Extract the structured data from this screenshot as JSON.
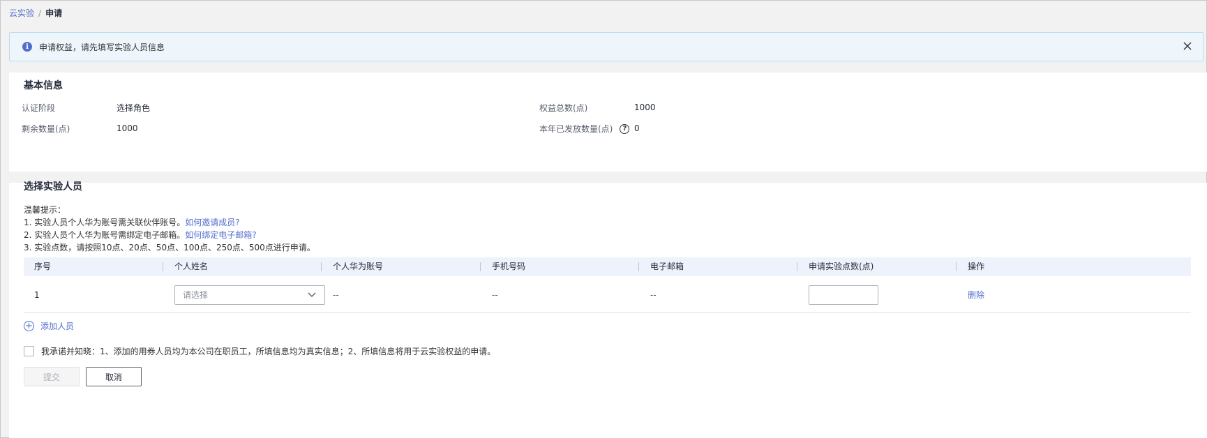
{
  "breadcrumb": {
    "parent": "云实验",
    "separator": "/",
    "current": "申请"
  },
  "alert": {
    "message": "申请权益，请先填写实验人员信息"
  },
  "basic_info": {
    "title": "基本信息",
    "stage_label": "认证阶段",
    "stage_value": "选择角色",
    "total_label": "权益总数(点)",
    "total_value": "1000",
    "remaining_label": "剩余数量(点)",
    "remaining_value": "1000",
    "issued_label": "本年已发放数量(点)",
    "issued_value": "0"
  },
  "select_staff": {
    "title": "选择实验人员",
    "tips_title": "温馨提示：",
    "tip1_text": "1. 实验人员个人华为账号需关联伙伴账号。",
    "tip1_link": "如何邀请成员?",
    "tip2_text": "2. 实验人员个人华为账号需绑定电子邮箱。",
    "tip2_link": "如何绑定电子邮箱?",
    "tip3_text": "3. 实验点数，请按照10点、20点、50点、100点、250点、500点进行申请。"
  },
  "table": {
    "headers": [
      "序号",
      "个人姓名",
      "个人华为账号",
      "手机号码",
      "电子邮箱",
      "申请实验点数(点)",
      "操作"
    ],
    "rows": [
      {
        "index": "1",
        "name_placeholder": "请选择",
        "account": "--",
        "phone": "--",
        "email": "--",
        "points": "",
        "action": "删除"
      }
    ]
  },
  "add_person_label": "添加人员",
  "agreement_text": "我承诺并知晓：1、添加的用券人员均为本公司在职员工，所填信息均为真实信息；2、所填信息将用于云实验权益的申请。",
  "buttons": {
    "submit": "提交",
    "cancel": "取消"
  },
  "colors": {
    "link": "#526ecc",
    "alert_bg": "#eef6fc",
    "table_header_bg": "#eef3fb"
  }
}
